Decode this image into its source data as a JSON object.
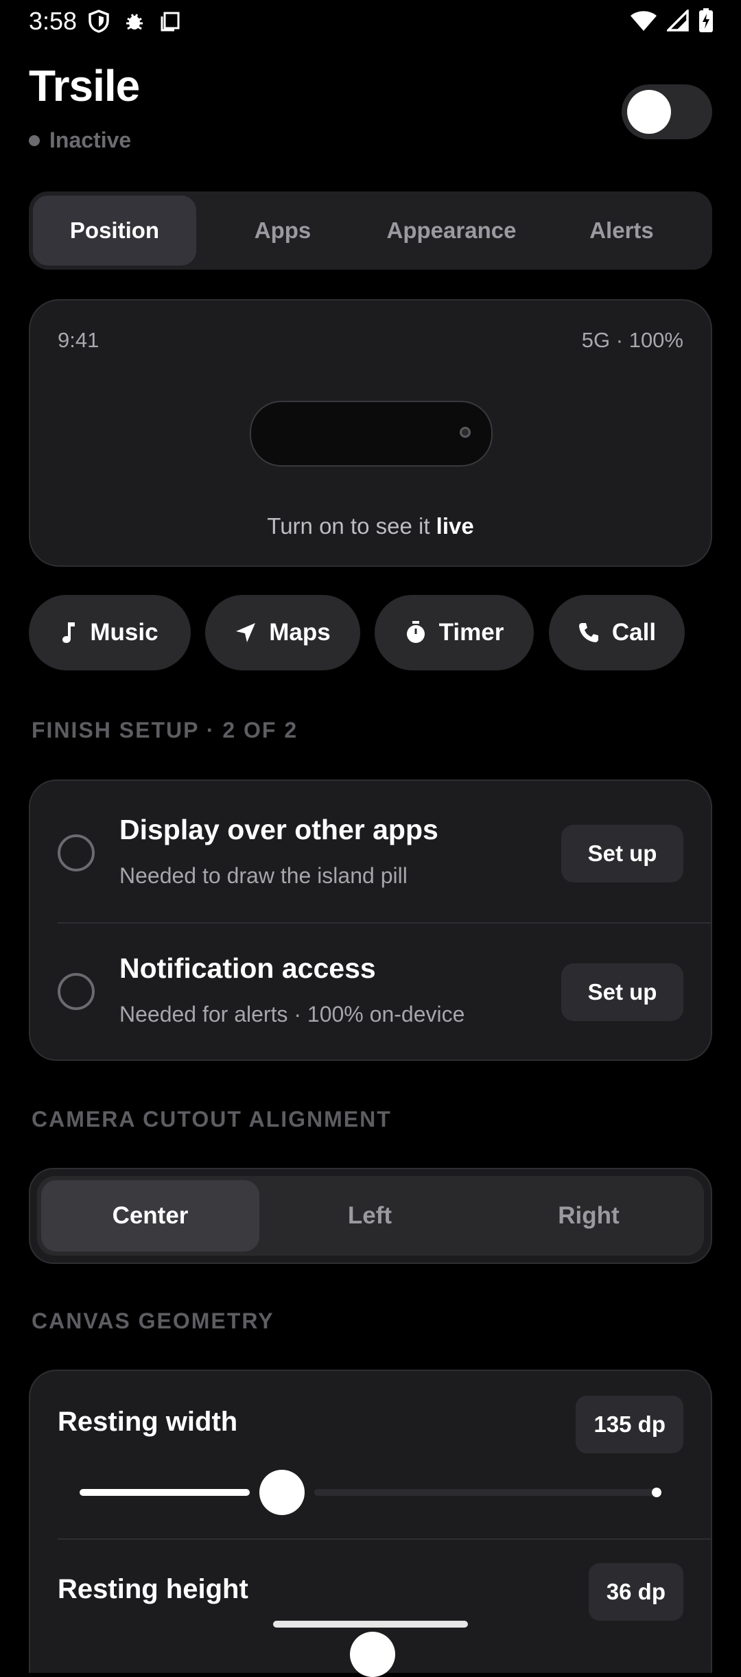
{
  "status_bar": {
    "time": "3:58",
    "left_icons": [
      "shield-icon",
      "bug-icon",
      "screen-icon"
    ],
    "right_icons": [
      "wifi-icon",
      "signal-icon",
      "battery-charging-icon"
    ]
  },
  "header": {
    "title": "Trsile",
    "status": "Inactive",
    "toggle_on": false
  },
  "tabs": [
    {
      "label": "Position",
      "active": true
    },
    {
      "label": "Apps",
      "active": false
    },
    {
      "label": "Appearance",
      "active": false
    },
    {
      "label": "Alerts",
      "active": false
    }
  ],
  "preview": {
    "time": "9:41",
    "network": "5G · 100%",
    "hint_prefix": "Turn on to see it ",
    "hint_bold": "live"
  },
  "chips": [
    {
      "label": "Music",
      "icon": "music-note-icon"
    },
    {
      "label": "Maps",
      "icon": "navigation-arrow-icon"
    },
    {
      "label": "Timer",
      "icon": "timer-icon"
    },
    {
      "label": "Call",
      "icon": "phone-icon"
    }
  ],
  "setup": {
    "label": "FINISH SETUP · 2 OF 2",
    "items": [
      {
        "title": "Display over other apps",
        "subtitle": "Needed to draw the island pill",
        "button": "Set up"
      },
      {
        "title": "Notification access",
        "subtitle": "Needed for alerts · 100% on-device",
        "button": "Set up"
      }
    ]
  },
  "alignment": {
    "label": "CAMERA CUTOUT ALIGNMENT",
    "options": [
      {
        "label": "Center",
        "active": true
      },
      {
        "label": "Left",
        "active": false
      },
      {
        "label": "Right",
        "active": false
      }
    ]
  },
  "geometry": {
    "label": "CANVAS GEOMETRY",
    "resting_width": {
      "label": "Resting width",
      "value": "135 dp"
    },
    "resting_height": {
      "label": "Resting height",
      "value": "36 dp"
    }
  }
}
